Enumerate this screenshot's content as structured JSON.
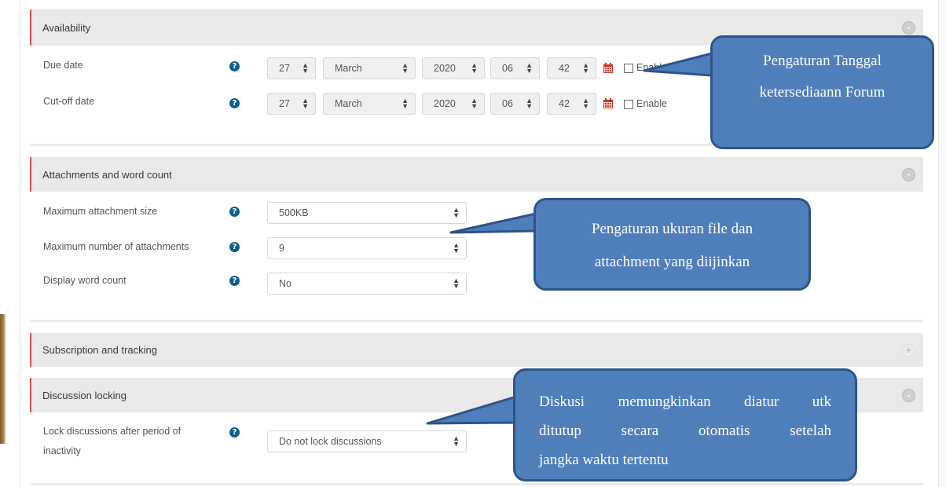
{
  "availability": {
    "title": "Availability",
    "due_date": {
      "label": "Due date",
      "day": "27",
      "month": "March",
      "year": "2020",
      "hour": "06",
      "minute": "42",
      "enable_label": "Enable"
    },
    "cutoff_date": {
      "label": "Cut-off date",
      "day": "27",
      "month": "March",
      "year": "2020",
      "hour": "06",
      "minute": "42",
      "enable_label": "Enable"
    }
  },
  "attachments": {
    "title": "Attachments and word count",
    "max_size": {
      "label": "Maximum attachment size",
      "value": "500KB"
    },
    "max_number": {
      "label": "Maximum number of attachments",
      "value": "9"
    },
    "word_count": {
      "label": "Display word count",
      "value": "No"
    }
  },
  "subscription": {
    "title": "Subscription and tracking"
  },
  "locking": {
    "title": "Discussion locking",
    "lock_label_line1": "Lock discussions after period of",
    "lock_label_line2": "inactivity",
    "lock_value": "Do not lock discussions"
  },
  "callouts": {
    "c1_line1": "Pengaturan Tanggal",
    "c1_line2": "ketersediaann Forum",
    "c2_line1": "Pengaturan ukuran file dan",
    "c2_line2": "attachment yang diijinkan",
    "c3_line1": "Diskusi memungkinkan diatur utk",
    "c3_line2": "ditutup secara otomatis setelah",
    "c3_line3": "jangka waktu tertentu"
  },
  "colors": {
    "callout_fill": "#4f7fbb",
    "callout_border": "#2d5486",
    "help_icon": "#0f5e8f",
    "section_accent": "#d9534f",
    "calendar_icon": "#c0392b"
  },
  "icons": [
    "help-icon",
    "calendar-icon",
    "collapse-icon",
    "expand-icon",
    "select-arrow-icon"
  ]
}
